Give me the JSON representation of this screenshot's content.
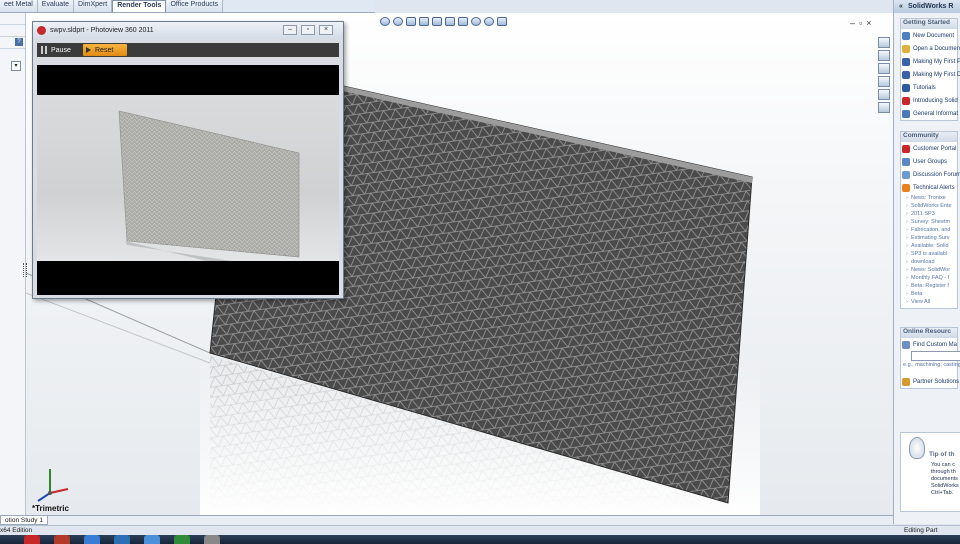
{
  "tabs": [
    "eet Metal",
    "Evaluate",
    "DimXpert",
    "Render Tools",
    "Office Products"
  ],
  "active_tab_index": 3,
  "viewport": {
    "view_label": "*Trimetric",
    "hud_icons": [
      "zoom-to-fit-icon",
      "zoom-area-icon",
      "previous-view-icon",
      "section-view-icon",
      "view-orientation-icon",
      "display-style-icon",
      "hide-show-icon",
      "edit-appearance-icon",
      "apply-scene-icon",
      "view-settings-icon"
    ]
  },
  "photoview": {
    "title": "swpv.sldprt - Photoview 360 2011",
    "pause_label": "Pause",
    "reset_label": "Reset"
  },
  "taskpane": {
    "header": "SolidWorks R",
    "getting_started": {
      "title": "Getting Started",
      "items": [
        {
          "label": "New Document",
          "color": "#4f7fc0"
        },
        {
          "label": "Open a Document",
          "color": "#e0b23c"
        },
        {
          "label": "Making My First P",
          "color": "#3b62a8"
        },
        {
          "label": "Making My First D",
          "color": "#3b62a8"
        },
        {
          "label": "Tutorials",
          "color": "#2f5aa0"
        },
        {
          "label": "Introducing Solid",
          "color": "#c8282b"
        },
        {
          "label": "General Informat",
          "color": "#4a78b8"
        }
      ]
    },
    "community": {
      "title": "Community",
      "items": [
        {
          "label": "Customer Portal",
          "color": "#c8282b"
        },
        {
          "label": "User Groups",
          "color": "#5a86c4"
        },
        {
          "label": "Discussion Forum",
          "color": "#6c9bd2"
        },
        {
          "label": "Technical Alerts",
          "color": "#e9821c"
        }
      ],
      "news": [
        "News: Tronixe",
        "SolidWorks Ente",
        "2011 SP3",
        "Survey: Sheetm",
        "Fabrication, and",
        "Estimating Surv",
        "Available: Solid",
        "SP3 is availabl",
        "download",
        "News: SolidWor",
        "Monthly FAQ - I",
        "Beta: Register f",
        "Beta",
        "View All"
      ]
    },
    "online_resources": {
      "title": "Online Resourc",
      "find_label": "Find Custom Ma",
      "hint": "e.g., machining, casting",
      "partner_label": "Partner Solutions"
    },
    "tip": {
      "title": "Tip of th",
      "text": "You can c through th documents SolidWorks Ctrl+Tab."
    }
  },
  "bottom": {
    "study_tab": "otion Study 1",
    "edition": "x64 Edition",
    "status_right": "Editing Part"
  }
}
